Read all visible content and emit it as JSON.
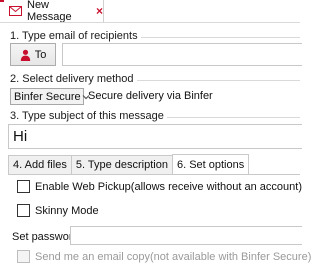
{
  "tab": {
    "title": "New Message",
    "close": "×"
  },
  "recipients": {
    "section_label": "1. Type email of recipients",
    "to_label": "To",
    "input_value": ""
  },
  "delivery": {
    "section_label": "2. Select delivery method",
    "selected": "Binfer Secure",
    "description": "Secure delivery via Binfer"
  },
  "subject": {
    "section_label": "3. Type subject of this message",
    "value": "Hi"
  },
  "tabs": [
    {
      "label": "4. Add files"
    },
    {
      "label": "5. Type description"
    },
    {
      "label": "6. Set options"
    }
  ],
  "options": {
    "web_pickup": {
      "label": "Enable Web Pickup(allows receive without an account)",
      "checked": false
    },
    "skinny_mode": {
      "label": "Skinny Mode",
      "checked": false
    },
    "password_label": "Set password",
    "password_value": "",
    "email_copy": {
      "label": "Send me an email copy(not available with Binfer Secure)",
      "checked": false,
      "disabled": true
    }
  },
  "colors": {
    "accent": "#c8102e"
  },
  "icons": {
    "mail": "mail-icon",
    "close": "close-icon",
    "person": "person-icon",
    "dropdown": "chevron-down-icon"
  }
}
